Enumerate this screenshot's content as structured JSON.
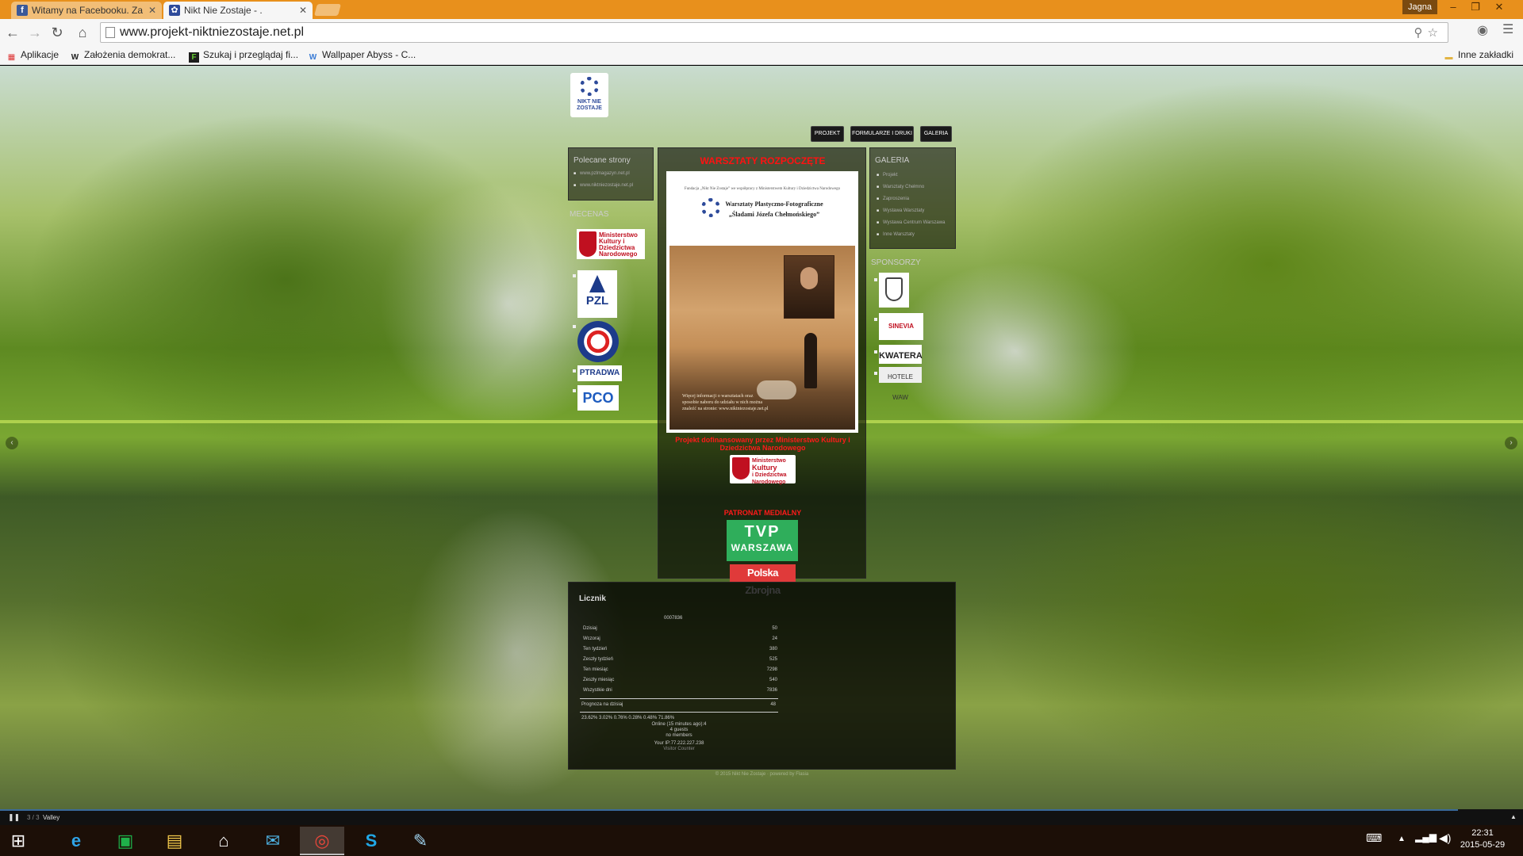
{
  "browser": {
    "tabs": [
      {
        "title": "Witamy na Facebooku. Za",
        "active": false,
        "icon": "facebook-icon"
      },
      {
        "title": "Nikt Nie Zostaje - .",
        "active": true,
        "icon": "site-icon"
      }
    ],
    "user": "Jagna",
    "url": "www.projekt-niktniezostaje.net.pl",
    "bookmarks": [
      {
        "label": "Aplikacje",
        "icon": "apps-icon"
      },
      {
        "label": "Założenia demokrat...",
        "icon": "wikipedia-icon"
      },
      {
        "label": "Szukaj i przeglądaj fi...",
        "icon": "film-icon"
      },
      {
        "label": "Wallpaper Abyss - C...",
        "icon": "wallpaper-icon"
      }
    ],
    "other_bookmarks": "Inne zakładki"
  },
  "site": {
    "logo_text": "NIKT NIE ZOSTAJE",
    "menu": [
      "PROJEKT",
      "FORMULARZE I DRUKI",
      "GALERIA"
    ],
    "links": {
      "title": "Polecane strony",
      "items": [
        "www.pzlmagazyn.net.pl",
        "www.niktniezostaje.net.pl"
      ]
    },
    "patrons_label": "MECENAS",
    "gallery": {
      "title": "GALERIA",
      "items": [
        "Projekt",
        "Warsztaty Chełmno",
        "Zaproszenia",
        "Wystawa Warsztaty",
        "Wystawa Centrum Warszawa",
        "Inne Warsztaty"
      ]
    },
    "sponsors_label": "SPONSORZY",
    "sponsors": [
      "ORZEŁ",
      "SINEVIA",
      "KWATERA",
      "HOTELE WAW"
    ],
    "patron_logos": [
      "Ministerstwo Kultury i Dziedzictwa Narodowego",
      "PZL",
      "Związek Strzelecki",
      "PTRADWA",
      "PCO"
    ],
    "headline": "WARSZTATY ROZPOCZĘTE",
    "poster": {
      "header": "Fundacja „Nikt Nie Zostaje” we współpracy z Ministerstwem Kultury i Dziedzictwa Narodowego",
      "title_line1": "Warsztaty Plastyczno-Fotograficzne",
      "title_line2": "„Śladami Józefa Chełmońskiego”",
      "more": "Więcej informacji o warsztatach oraz sposobie naboru do udziału w nich można znaleźć na stronie: www.niktniezostaje.net.pl"
    },
    "cofinance": "Projekt dofinansowany przez Ministerstwo Kultury i Dziedzictwa Narodowego",
    "ministry_logo": [
      "Ministerstwo",
      "Kultury",
      "i Dziedzictwa",
      "Narodowego"
    ],
    "media_label": "PATRONAT MEDIALNY",
    "tvp": {
      "top": "TVP",
      "bottom": "WARSZAWA"
    },
    "polska_zbrojna": "Polska Zbrojna",
    "counter": {
      "title": "Licznik",
      "total_digits": "0007836",
      "rows": [
        {
          "label": "Dzisiaj",
          "value": "50"
        },
        {
          "label": "Wczoraj",
          "value": "24"
        },
        {
          "label": "Ten tydzień",
          "value": "380"
        },
        {
          "label": "Zeszły tydzień",
          "value": "525"
        },
        {
          "label": "Ten miesiąc",
          "value": "7298"
        },
        {
          "label": "Zeszły miesiąc",
          "value": "540"
        },
        {
          "label": "Wszystkie dni",
          "value": "7836"
        }
      ],
      "forecast_label": "Prognoza na dzisiaj",
      "forecast_value": "48",
      "browsers": "23.62%  3.02%  0.76%  0.28%  0.48%  71.86%",
      "online": "Online (15 minutes ago):4",
      "guests": "4 guests",
      "members": "no members",
      "ip": "Your IP:77.222.227.238",
      "footer": "Visitor Counter"
    },
    "footer_note": "© 2015 Nikt Nie Zostaje · powered by Flasia"
  },
  "slideshow": {
    "counter": "3 / 3",
    "name": "Valley"
  },
  "taskbar": {
    "time": "22:31",
    "date": "2015-05-29",
    "apps": [
      "start-icon",
      "ie-icon",
      "store-icon",
      "explorer-icon",
      "home-icon",
      "mail-icon",
      "chrome-icon",
      "skype-icon",
      "paint-icon"
    ]
  }
}
